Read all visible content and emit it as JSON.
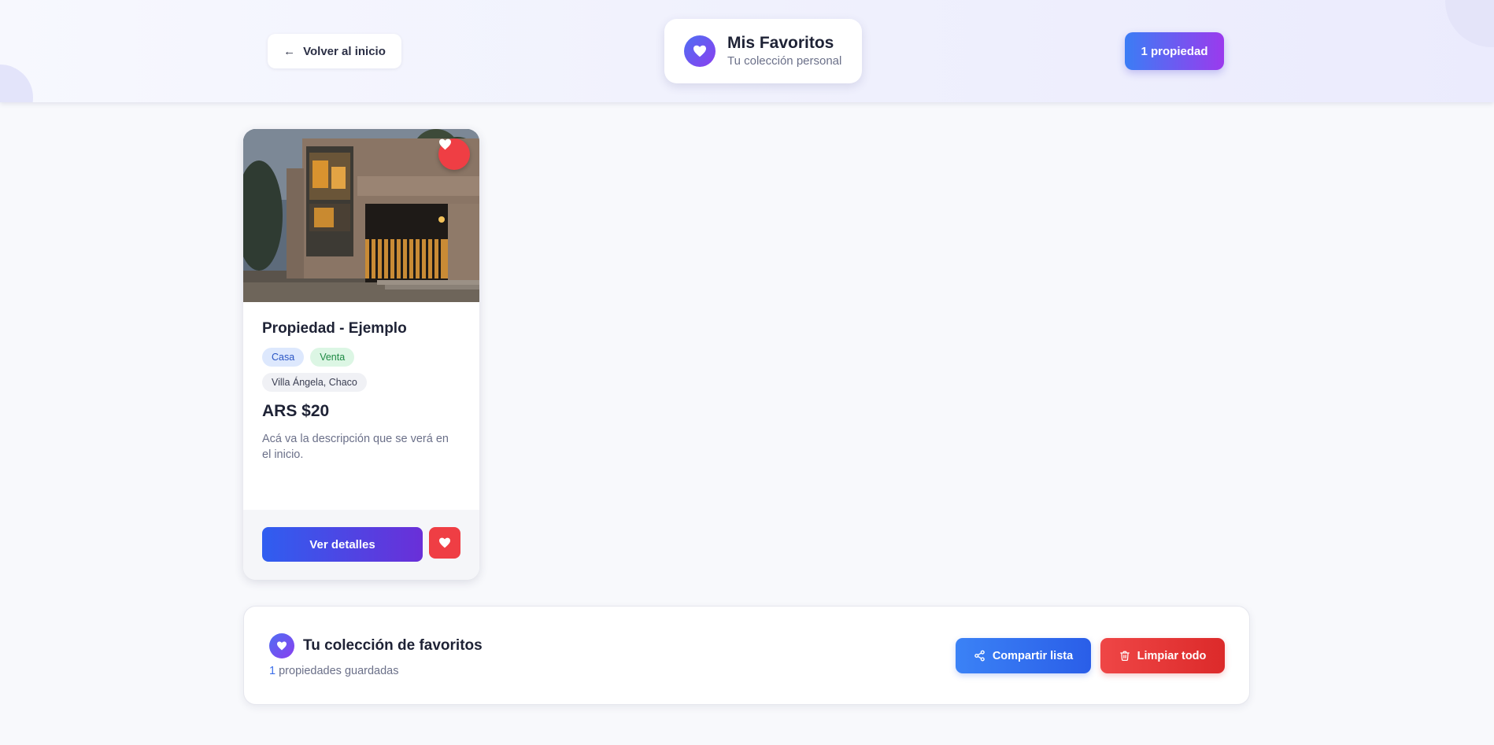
{
  "header": {
    "back_label": "Volver al inicio",
    "back_icon": "arrow-left-icon",
    "title": "Mis Favoritos",
    "subtitle": "Tu colección personal",
    "title_icon": "heart-icon",
    "count_label": "1 propiedad"
  },
  "property": {
    "title": "Propiedad - Ejemplo",
    "type": "Casa",
    "operation": "Venta",
    "location": "Villa Ángela, Chaco",
    "price": "ARS $20",
    "description": "Acá va la descripción que se verá en el inicio.",
    "details_label": "Ver detalles",
    "favorite_icon": "heart-icon",
    "photo_alt": "modern concrete house exterior"
  },
  "summary": {
    "title": "Tu colección de favoritos",
    "count": "1",
    "count_suffix": " propiedades guardadas",
    "share_label": "Compartir lista",
    "share_icon": "share-icon",
    "clear_label": "Limpiar todo",
    "clear_icon": "trash-icon"
  },
  "colors": {
    "accent_gradient_start": "#3b7df5",
    "accent_gradient_end": "#9b3aed",
    "danger": "#ef3e44",
    "share_blue": "#3b82f6",
    "background": "#f8f9fc"
  }
}
